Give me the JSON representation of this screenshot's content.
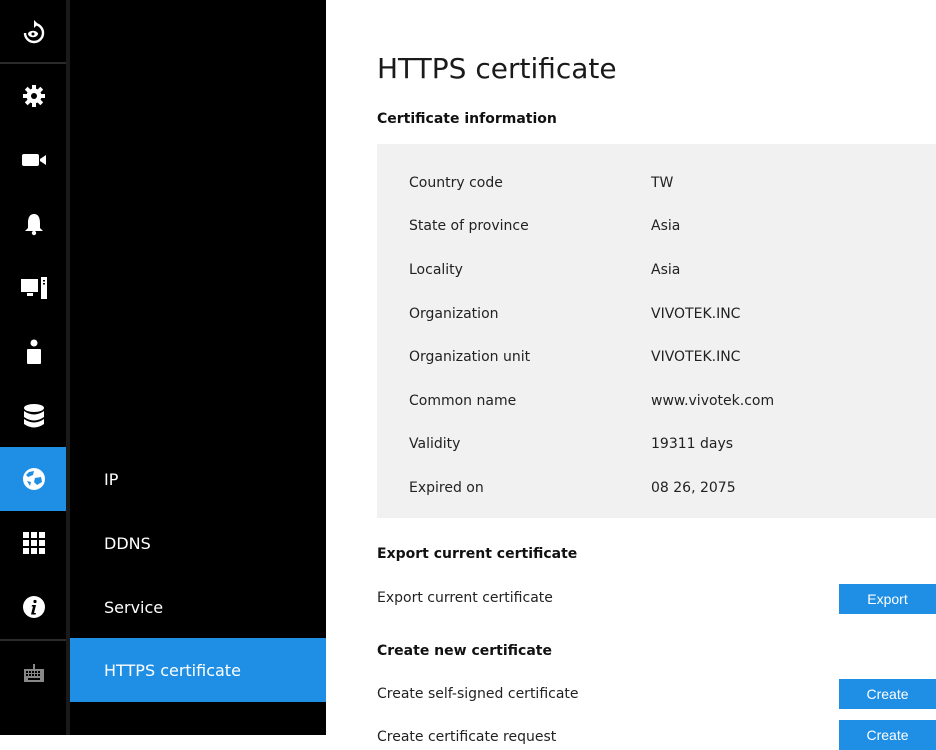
{
  "rail": {
    "items": [
      {
        "icon": "live-view-icon",
        "active": false
      },
      {
        "icon": "gear-icon",
        "active": false
      },
      {
        "icon": "camera-icon",
        "active": false
      },
      {
        "icon": "bell-icon",
        "active": false
      },
      {
        "icon": "system-icon",
        "active": false
      },
      {
        "icon": "user-icon",
        "active": false
      },
      {
        "icon": "storage-icon",
        "active": false
      },
      {
        "icon": "network-globe-icon",
        "active": true
      },
      {
        "icon": "grid-icon",
        "active": false
      },
      {
        "icon": "info-icon",
        "active": false
      },
      {
        "icon": "keyboard-icon",
        "active": false
      }
    ],
    "accent": "#1f8fe6"
  },
  "submenu": {
    "items": [
      {
        "label": "IP",
        "active": false
      },
      {
        "label": "DDNS",
        "active": false
      },
      {
        "label": "Service",
        "active": false
      },
      {
        "label": "HTTPS certificate",
        "active": true
      }
    ]
  },
  "main": {
    "title": "HTTPS certificate",
    "info_section_title": "Certificate information",
    "info": [
      {
        "key": "Country code",
        "value": "TW"
      },
      {
        "key": "State of province",
        "value": "Asia"
      },
      {
        "key": "Locality",
        "value": "Asia"
      },
      {
        "key": "Organization",
        "value": "VIVOTEK.INC"
      },
      {
        "key": "Organization unit",
        "value": "VIVOTEK.INC"
      },
      {
        "key": "Common name",
        "value": "www.vivotek.com"
      },
      {
        "key": "Validity",
        "value": "19311 days"
      },
      {
        "key": "Expired on",
        "value": "08 26, 2075"
      }
    ],
    "export_section_title": "Export current certificate",
    "export_label": "Export current certificate",
    "export_button": "Export",
    "create_section_title": "Create new certificate",
    "self_signed_label": "Create self-signed certificate",
    "self_signed_button": "Create",
    "request_label": "Create certificate request",
    "request_button": "Create"
  }
}
